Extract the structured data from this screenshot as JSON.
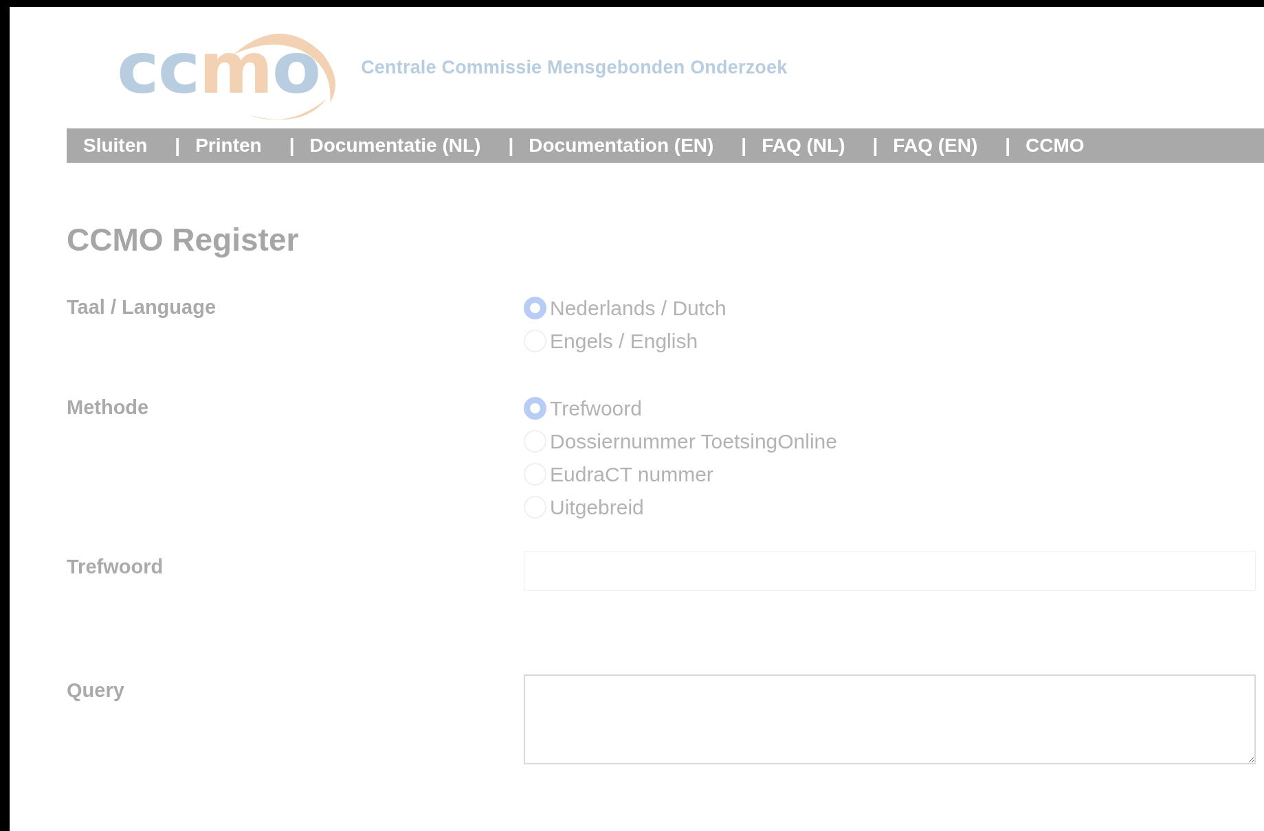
{
  "header": {
    "logo": [
      {
        "text": "cc",
        "color": "#b9cde0"
      },
      {
        "text": "m",
        "color": "#f2d2b3"
      },
      {
        "text": "o",
        "color": "#b9cde0"
      }
    ],
    "tagline": "Centrale Commissie Mensgebonden Onderzoek"
  },
  "nav": [
    "Sluiten",
    "Printen",
    "Documentatie (NL)",
    "Documentation (EN)",
    "FAQ (NL)",
    "FAQ (EN)",
    "CCMO"
  ],
  "nav_separator": "|",
  "title": "CCMO Register",
  "fields": [
    {
      "kind": "radio",
      "label": "Taal / Language",
      "options": [
        {
          "label": "Nederlands / Dutch",
          "selected": true
        },
        {
          "label": "Engels / English",
          "selected": false
        }
      ]
    },
    {
      "kind": "radio",
      "label": "Methode",
      "options": [
        {
          "label": "Trefwoord",
          "selected": true
        },
        {
          "label": "Dossiernummer ToetsingOnline",
          "selected": false
        },
        {
          "label": "EudraCT nummer",
          "selected": false
        },
        {
          "label": "Uitgebreid",
          "selected": false
        }
      ]
    },
    {
      "kind": "text",
      "label": "Trefwoord"
    },
    {
      "kind": "textarea",
      "label": "Query"
    }
  ]
}
